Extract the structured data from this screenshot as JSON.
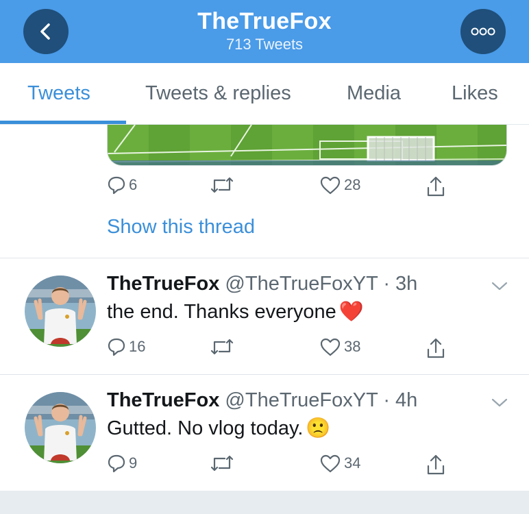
{
  "header": {
    "title": "TheTrueFox",
    "subtitle": "713 Tweets",
    "back_icon": "chevron-left-icon",
    "more_icon": "more-dots-icon",
    "bg_color": "#4a9be8"
  },
  "tabs": [
    {
      "label": "Tweets",
      "active": true
    },
    {
      "label": "Tweets & replies",
      "active": false
    },
    {
      "label": "Media",
      "active": false
    },
    {
      "label": "Likes",
      "active": false
    }
  ],
  "thread_tweet": {
    "reply_count": "6",
    "retweet_count": "",
    "like_count": "28",
    "show_thread": "Show this thread"
  },
  "tweets": [
    {
      "name": "TheTrueFox",
      "handle": "@TheTrueFoxYT",
      "time": "3h",
      "text": "the end. Thanks everyone",
      "emoji": "❤️",
      "reply_count": "16",
      "like_count": "38"
    },
    {
      "name": "TheTrueFox",
      "handle": "@TheTrueFoxYT",
      "time": "4h",
      "text": "Gutted. No vlog today.",
      "emoji": "🙁",
      "reply_count": "9",
      "like_count": "34"
    }
  ],
  "separator": " · ",
  "accent_color": "#3b8fd9"
}
